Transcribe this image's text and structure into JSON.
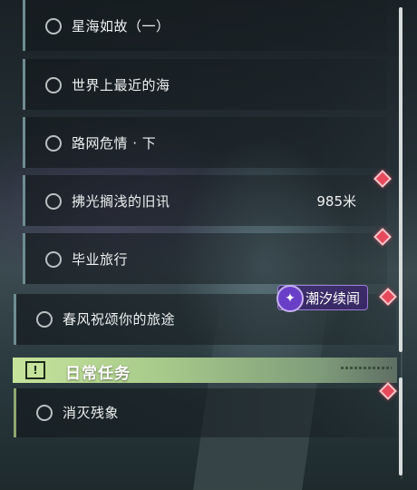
{
  "quests": [
    {
      "title": "星海如故（一）",
      "distance": ""
    },
    {
      "title": "世界上最近的海",
      "distance": ""
    },
    {
      "title": "路网危情 · 下",
      "distance": ""
    },
    {
      "title": "拂光搁浅的旧讯",
      "distance": "985米"
    },
    {
      "title": "毕业旅行",
      "distance": ""
    },
    {
      "title": "春风祝颂你的旅途",
      "distance": ""
    }
  ],
  "tag": {
    "label": "潮汐续闻",
    "icon": "sparkle-icon"
  },
  "daily_section": {
    "title": "日常任务",
    "icon": "exclamation-icon"
  },
  "daily_quests": [
    {
      "title": "消灭残象"
    }
  ],
  "colors": {
    "accent_green": "#c6e39b",
    "marker_red": "#e64a5c",
    "tag_purple": "#6a3fc7"
  }
}
